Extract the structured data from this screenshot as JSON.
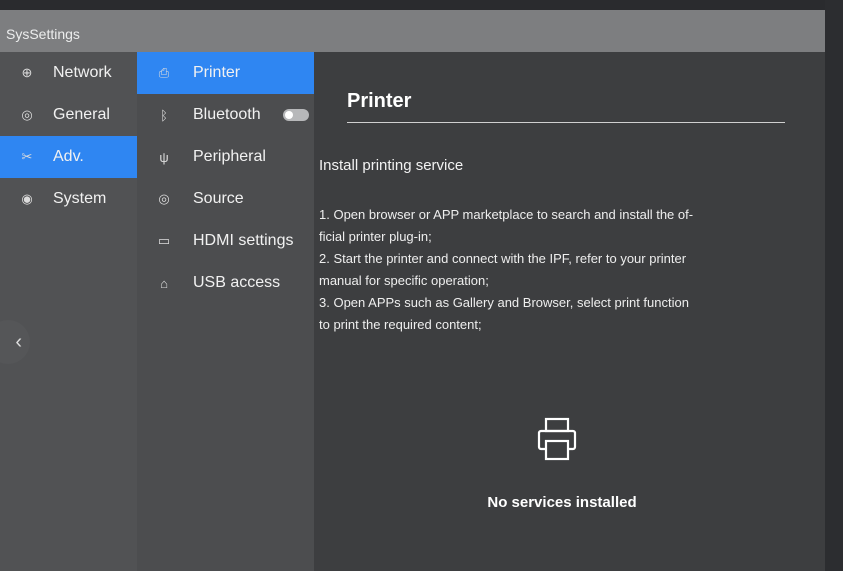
{
  "app": {
    "title": "SysSettings"
  },
  "sidebar": {
    "items": [
      {
        "label": "Network",
        "icon": "globe-icon"
      },
      {
        "label": "General",
        "icon": "palette-icon"
      },
      {
        "label": "Adv.",
        "icon": "tools-icon",
        "active": true
      },
      {
        "label": "System",
        "icon": "system-icon"
      }
    ]
  },
  "submenu": {
    "items": [
      {
        "label": "Printer",
        "icon": "printer-icon",
        "active": true
      },
      {
        "label": "Bluetooth",
        "icon": "bluetooth-icon",
        "toggle": "off"
      },
      {
        "label": "Peripheral",
        "icon": "usb-icon"
      },
      {
        "label": "Source",
        "icon": "source-icon"
      },
      {
        "label": "HDMI settings",
        "icon": "hdmi-icon"
      },
      {
        "label": "USB access",
        "icon": "usb-lock-icon"
      }
    ]
  },
  "main": {
    "title": "Printer",
    "section": "Install printing service",
    "steps": [
      "1. Open browser or APP marketplace to search and install the of-",
      "ficial printer plug-in;",
      "2. Start the printer and connect with the IPF, refer to your printer",
      "manual for specific operation;",
      "3. Open APPs such as Gallery and Browser, select print function",
      "to print the required content;"
    ],
    "empty_state": "No services installed"
  },
  "colors": {
    "accent": "#2f86f2"
  }
}
